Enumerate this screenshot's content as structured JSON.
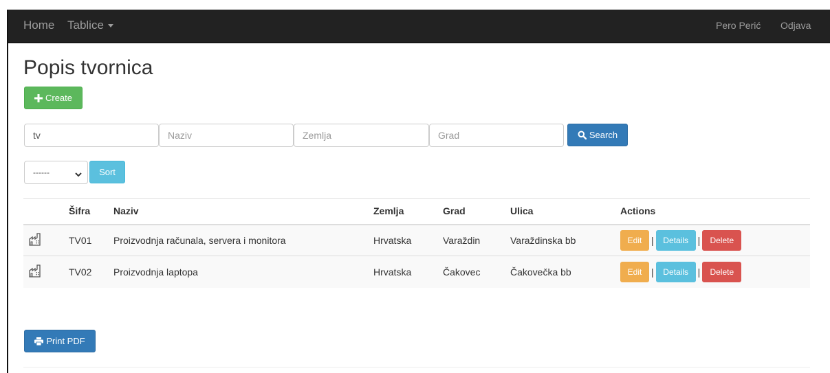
{
  "navbar": {
    "home": "Home",
    "tablice": "Tablice",
    "user": "Pero Perić",
    "logout": "Odjava"
  },
  "page": {
    "title": "Popis tvornica"
  },
  "toolbar": {
    "create_label": "Create",
    "print_label": "Print PDF"
  },
  "search": {
    "sifra_value": "tv",
    "naziv_placeholder": "Naziv",
    "zemlja_placeholder": "Zemlja",
    "grad_placeholder": "Grad",
    "button_label": "Search"
  },
  "sort": {
    "selected": "------",
    "button_label": "Sort"
  },
  "table": {
    "headers": {
      "sifra": "Šifra",
      "naziv": "Naziv",
      "zemlja": "Zemlja",
      "grad": "Grad",
      "ulica": "Ulica",
      "actions": "Actions"
    },
    "rows": [
      {
        "sifra": "TV01",
        "naziv": "Proizvodnja računala, servera i monitora",
        "zemlja": "Hrvatska",
        "grad": "Varaždin",
        "ulica": "Varaždinska bb"
      },
      {
        "sifra": "TV02",
        "naziv": "Proizvodnja laptopa",
        "zemlja": "Hrvatska",
        "grad": "Čakovec",
        "ulica": "Čakovečka bb"
      }
    ],
    "actions": {
      "edit": "Edit",
      "details": "Details",
      "delete": "Delete",
      "separator": "|"
    }
  },
  "icons": {
    "row_icon": "factory-icon",
    "create_icon": "plus-icon",
    "search_icon": "search-icon",
    "print_icon": "print-icon"
  },
  "colors": {
    "navbar": "#222222",
    "success": "#5cb85c",
    "primary": "#337ab7",
    "info": "#5bc0de",
    "warning": "#f0ad4e",
    "danger": "#d9534f"
  }
}
